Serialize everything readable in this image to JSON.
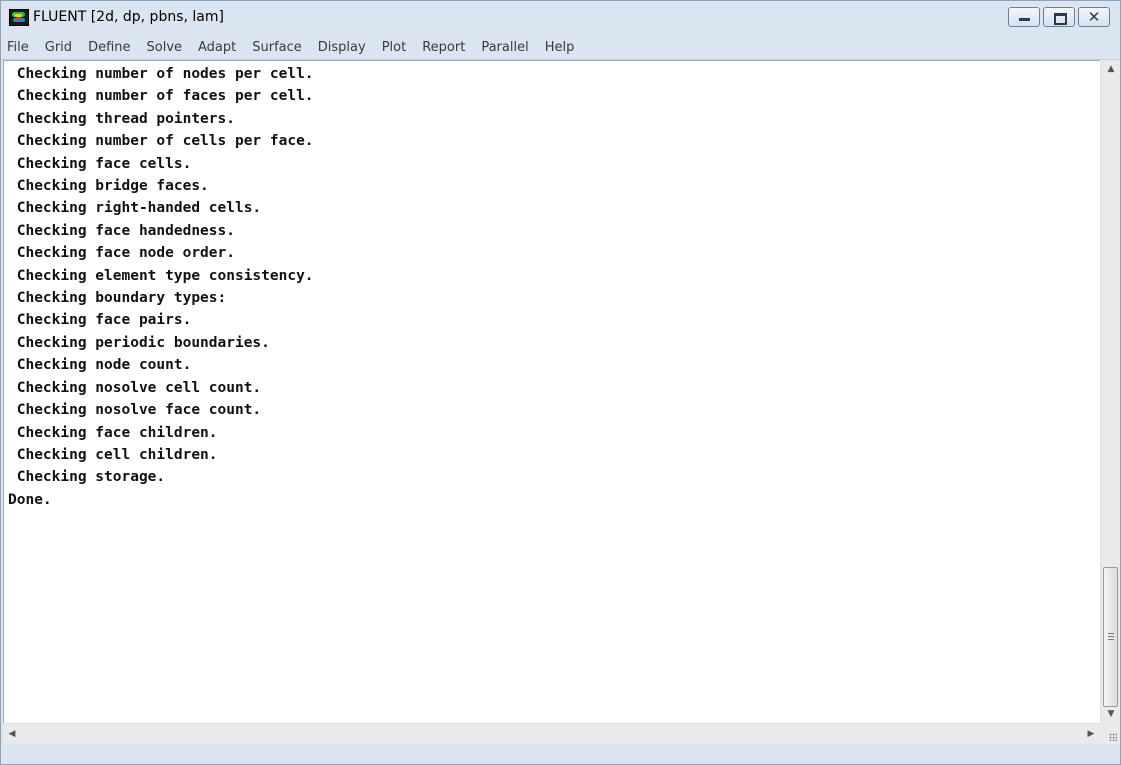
{
  "window": {
    "title": "FLUENT  [2d, dp, pbns, lam]",
    "app_icon": "fluent-app-icon",
    "controls": {
      "minimize_icon": "minimize-icon",
      "maximize_icon": "maximize-icon",
      "close_icon": "close-icon",
      "close_glyph": "✕"
    }
  },
  "menubar": {
    "items": [
      "File",
      "Grid",
      "Define",
      "Solve",
      "Adapt",
      "Surface",
      "Display",
      "Plot",
      "Report",
      "Parallel",
      "Help"
    ]
  },
  "console": {
    "lines": [
      " Checking number of nodes per cell.",
      " Checking number of faces per cell.",
      " Checking thread pointers.",
      " Checking number of cells per face.",
      " Checking face cells.",
      " Checking bridge faces.",
      " Checking right-handed cells.",
      " Checking face handedness.",
      " Checking face node order.",
      " Checking element type consistency.",
      " Checking boundary types:",
      " Checking face pairs.",
      " Checking periodic boundaries.",
      " Checking node count.",
      " Checking nosolve cell count.",
      " Checking nosolve face count.",
      " Checking face children.",
      " Checking cell children.",
      " Checking storage.",
      "Done."
    ]
  },
  "scrollbars": {
    "up_glyph": "▲",
    "down_glyph": "▼",
    "left_glyph": "◀",
    "right_glyph": "▶"
  }
}
